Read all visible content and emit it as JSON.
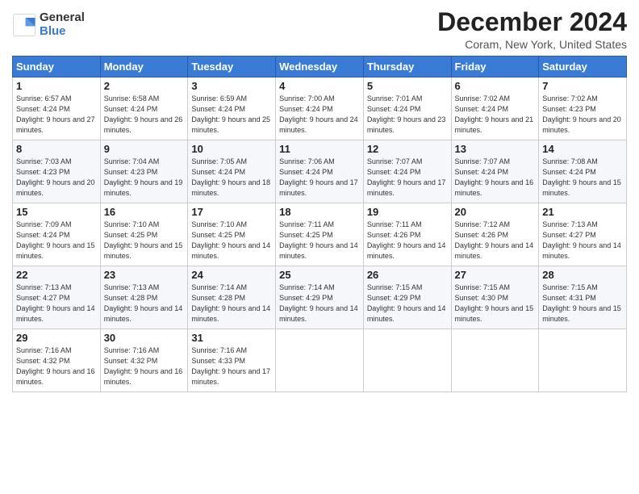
{
  "header": {
    "logo_general": "General",
    "logo_blue": "Blue",
    "title": "December 2024",
    "subtitle": "Coram, New York, United States"
  },
  "days_of_week": [
    "Sunday",
    "Monday",
    "Tuesday",
    "Wednesday",
    "Thursday",
    "Friday",
    "Saturday"
  ],
  "weeks": [
    [
      {
        "day": "1",
        "sunrise": "Sunrise: 6:57 AM",
        "sunset": "Sunset: 4:24 PM",
        "daylight": "Daylight: 9 hours and 27 minutes."
      },
      {
        "day": "2",
        "sunrise": "Sunrise: 6:58 AM",
        "sunset": "Sunset: 4:24 PM",
        "daylight": "Daylight: 9 hours and 26 minutes."
      },
      {
        "day": "3",
        "sunrise": "Sunrise: 6:59 AM",
        "sunset": "Sunset: 4:24 PM",
        "daylight": "Daylight: 9 hours and 25 minutes."
      },
      {
        "day": "4",
        "sunrise": "Sunrise: 7:00 AM",
        "sunset": "Sunset: 4:24 PM",
        "daylight": "Daylight: 9 hours and 24 minutes."
      },
      {
        "day": "5",
        "sunrise": "Sunrise: 7:01 AM",
        "sunset": "Sunset: 4:24 PM",
        "daylight": "Daylight: 9 hours and 23 minutes."
      },
      {
        "day": "6",
        "sunrise": "Sunrise: 7:02 AM",
        "sunset": "Sunset: 4:24 PM",
        "daylight": "Daylight: 9 hours and 21 minutes."
      },
      {
        "day": "7",
        "sunrise": "Sunrise: 7:02 AM",
        "sunset": "Sunset: 4:23 PM",
        "daylight": "Daylight: 9 hours and 20 minutes."
      }
    ],
    [
      {
        "day": "8",
        "sunrise": "Sunrise: 7:03 AM",
        "sunset": "Sunset: 4:23 PM",
        "daylight": "Daylight: 9 hours and 20 minutes."
      },
      {
        "day": "9",
        "sunrise": "Sunrise: 7:04 AM",
        "sunset": "Sunset: 4:23 PM",
        "daylight": "Daylight: 9 hours and 19 minutes."
      },
      {
        "day": "10",
        "sunrise": "Sunrise: 7:05 AM",
        "sunset": "Sunset: 4:24 PM",
        "daylight": "Daylight: 9 hours and 18 minutes."
      },
      {
        "day": "11",
        "sunrise": "Sunrise: 7:06 AM",
        "sunset": "Sunset: 4:24 PM",
        "daylight": "Daylight: 9 hours and 17 minutes."
      },
      {
        "day": "12",
        "sunrise": "Sunrise: 7:07 AM",
        "sunset": "Sunset: 4:24 PM",
        "daylight": "Daylight: 9 hours and 17 minutes."
      },
      {
        "day": "13",
        "sunrise": "Sunrise: 7:07 AM",
        "sunset": "Sunset: 4:24 PM",
        "daylight": "Daylight: 9 hours and 16 minutes."
      },
      {
        "day": "14",
        "sunrise": "Sunrise: 7:08 AM",
        "sunset": "Sunset: 4:24 PM",
        "daylight": "Daylight: 9 hours and 15 minutes."
      }
    ],
    [
      {
        "day": "15",
        "sunrise": "Sunrise: 7:09 AM",
        "sunset": "Sunset: 4:24 PM",
        "daylight": "Daylight: 9 hours and 15 minutes."
      },
      {
        "day": "16",
        "sunrise": "Sunrise: 7:10 AM",
        "sunset": "Sunset: 4:25 PM",
        "daylight": "Daylight: 9 hours and 15 minutes."
      },
      {
        "day": "17",
        "sunrise": "Sunrise: 7:10 AM",
        "sunset": "Sunset: 4:25 PM",
        "daylight": "Daylight: 9 hours and 14 minutes."
      },
      {
        "day": "18",
        "sunrise": "Sunrise: 7:11 AM",
        "sunset": "Sunset: 4:25 PM",
        "daylight": "Daylight: 9 hours and 14 minutes."
      },
      {
        "day": "19",
        "sunrise": "Sunrise: 7:11 AM",
        "sunset": "Sunset: 4:26 PM",
        "daylight": "Daylight: 9 hours and 14 minutes."
      },
      {
        "day": "20",
        "sunrise": "Sunrise: 7:12 AM",
        "sunset": "Sunset: 4:26 PM",
        "daylight": "Daylight: 9 hours and 14 minutes."
      },
      {
        "day": "21",
        "sunrise": "Sunrise: 7:13 AM",
        "sunset": "Sunset: 4:27 PM",
        "daylight": "Daylight: 9 hours and 14 minutes."
      }
    ],
    [
      {
        "day": "22",
        "sunrise": "Sunrise: 7:13 AM",
        "sunset": "Sunset: 4:27 PM",
        "daylight": "Daylight: 9 hours and 14 minutes."
      },
      {
        "day": "23",
        "sunrise": "Sunrise: 7:13 AM",
        "sunset": "Sunset: 4:28 PM",
        "daylight": "Daylight: 9 hours and 14 minutes."
      },
      {
        "day": "24",
        "sunrise": "Sunrise: 7:14 AM",
        "sunset": "Sunset: 4:28 PM",
        "daylight": "Daylight: 9 hours and 14 minutes."
      },
      {
        "day": "25",
        "sunrise": "Sunrise: 7:14 AM",
        "sunset": "Sunset: 4:29 PM",
        "daylight": "Daylight: 9 hours and 14 minutes."
      },
      {
        "day": "26",
        "sunrise": "Sunrise: 7:15 AM",
        "sunset": "Sunset: 4:29 PM",
        "daylight": "Daylight: 9 hours and 14 minutes."
      },
      {
        "day": "27",
        "sunrise": "Sunrise: 7:15 AM",
        "sunset": "Sunset: 4:30 PM",
        "daylight": "Daylight: 9 hours and 15 minutes."
      },
      {
        "day": "28",
        "sunrise": "Sunrise: 7:15 AM",
        "sunset": "Sunset: 4:31 PM",
        "daylight": "Daylight: 9 hours and 15 minutes."
      }
    ],
    [
      {
        "day": "29",
        "sunrise": "Sunrise: 7:16 AM",
        "sunset": "Sunset: 4:32 PM",
        "daylight": "Daylight: 9 hours and 16 minutes."
      },
      {
        "day": "30",
        "sunrise": "Sunrise: 7:16 AM",
        "sunset": "Sunset: 4:32 PM",
        "daylight": "Daylight: 9 hours and 16 minutes."
      },
      {
        "day": "31",
        "sunrise": "Sunrise: 7:16 AM",
        "sunset": "Sunset: 4:33 PM",
        "daylight": "Daylight: 9 hours and 17 minutes."
      },
      null,
      null,
      null,
      null
    ]
  ]
}
